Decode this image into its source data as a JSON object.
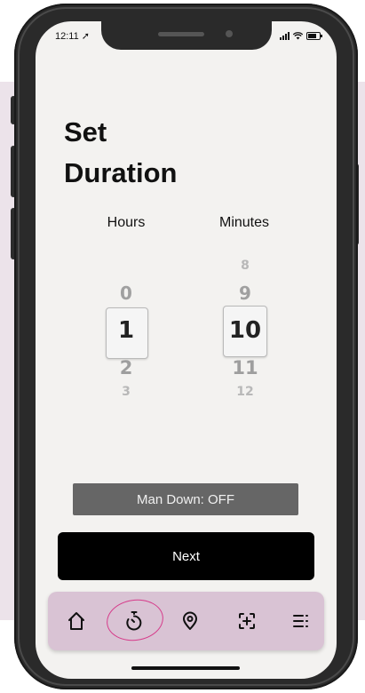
{
  "status_bar": {
    "time": "12:11 ➚"
  },
  "screen": {
    "title_line1": "Set",
    "title_line2": "Duration"
  },
  "picker": {
    "hours_label": "Hours",
    "minutes_label": "Minutes",
    "hours": {
      "above2": "",
      "above1": "0",
      "selected": "1",
      "below1": "2",
      "below2": "3"
    },
    "minutes": {
      "above2": "8",
      "above1": "9",
      "selected": "10",
      "below1": "11",
      "below2": "12"
    }
  },
  "man_down": {
    "label": "Man Down: OFF"
  },
  "next_button": {
    "label": "Next"
  },
  "tab_bar": {
    "items": [
      {
        "icon": "home-icon",
        "active": false
      },
      {
        "icon": "timer-icon",
        "active": true
      },
      {
        "icon": "location-pin-icon",
        "active": false
      },
      {
        "icon": "add-frame-icon",
        "active": false
      },
      {
        "icon": "menu-icon",
        "active": false
      }
    ],
    "background": "#d9c3d4",
    "active_ring_color": "#d63b8a"
  },
  "colors": {
    "background_band": "#ece3ea",
    "screen": "#f3f2f0",
    "man_down_bg": "#666666",
    "next_bg": "#000000"
  }
}
